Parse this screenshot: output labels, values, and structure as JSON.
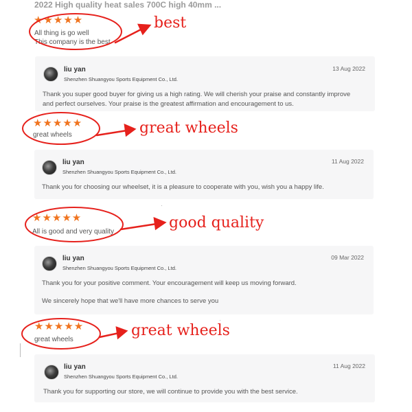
{
  "product_title": "2022 High quality heat sales 700C high 40mm ...",
  "reviews": [
    {
      "stars": "★★★★★",
      "text_lines": [
        "All thing is go well",
        "This company is the best"
      ],
      "annotation": "best",
      "reply": {
        "name": "liu yan",
        "company": "Shenzhen Shuangyou Sports Equipment Co., Ltd.",
        "date": "13 Aug 2022",
        "lines": [
          "Thank you super good buyer for giving us a high rating. We will cherish your praise and constantly improve",
          "and perfect ourselves. Your praise is the greatest affirmation and encouragement to us."
        ]
      }
    },
    {
      "stars": "★★★★★",
      "text_lines": [
        "great wheels"
      ],
      "annotation": "great wheels",
      "reply": {
        "name": "liu yan",
        "company": "Shenzhen Shuangyou Sports Equipment Co., Ltd.",
        "date": "11 Aug 2022",
        "lines": [
          "Thank you for choosing our wheelset, it is a pleasure to cooperate with you, wish you a happy life."
        ]
      }
    },
    {
      "stars": "★★★★★",
      "text_lines": [
        "All is good and very quality"
      ],
      "annotation": "good quality",
      "reply": {
        "name": "liu yan",
        "company": "Shenzhen Shuangyou Sports Equipment Co., Ltd.",
        "date": "09 Mar 2022",
        "lines": [
          "Thank you for your positive comment. Your encouragement will keep us moving forward.",
          "",
          "We sincerely hope that we'll have more chances to serve you"
        ]
      }
    },
    {
      "stars": "★★★★★",
      "text_lines": [
        "great wheels"
      ],
      "annotation": "great wheels",
      "reply": {
        "name": "liu yan",
        "company": "Shenzhen Shuangyou Sports Equipment Co., Ltd.",
        "date": "11 Aug 2022",
        "lines": [
          "Thank you for supporting our store, we will continue to provide you with the best service."
        ]
      }
    }
  ],
  "colors": {
    "annotation": "#e6211c",
    "stars": "#f0741f",
    "reply_bg": "#f6f6f7"
  }
}
